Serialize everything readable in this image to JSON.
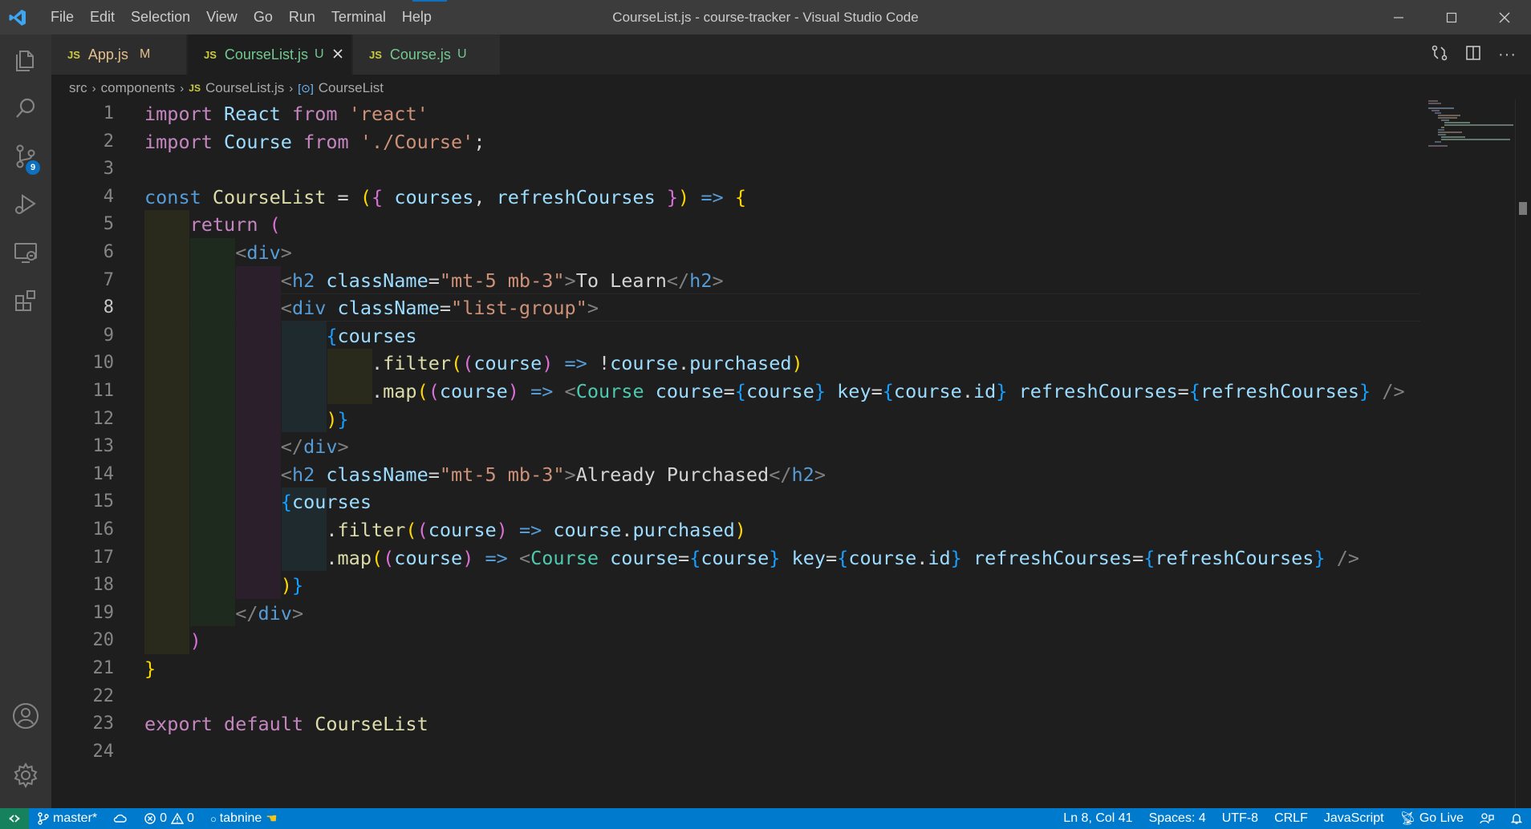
{
  "titlebar": {
    "menu": [
      "File",
      "Edit",
      "Selection",
      "View",
      "Go",
      "Run",
      "Terminal",
      "Help"
    ],
    "title": "CourseList.js - course-tracker - Visual Studio Code",
    "controls": [
      "minimize-icon",
      "maximize-icon",
      "close-icon"
    ]
  },
  "activity": {
    "items": [
      "explorer-icon",
      "search-icon",
      "source-control-icon",
      "run-debug-icon",
      "remote-explorer-icon",
      "extensions-icon",
      "account-icon",
      "settings-gear-icon"
    ],
    "scm_badge": "9"
  },
  "tabs": [
    {
      "icon": "JS",
      "name": "App.js",
      "status": "M",
      "active": false
    },
    {
      "icon": "JS",
      "name": "CourseList.js",
      "status": "U",
      "active": true
    },
    {
      "icon": "JS",
      "name": "Course.js",
      "status": "U",
      "active": false
    }
  ],
  "breadcrumb": {
    "parts": [
      "src",
      "components"
    ],
    "file_icon": "JS",
    "file": "CourseList.js",
    "symbol": "CourseList"
  },
  "editor": {
    "current_line": 8,
    "line_numbers": [
      "1",
      "2",
      "3",
      "4",
      "5",
      "6",
      "7",
      "8",
      "9",
      "10",
      "11",
      "12",
      "13",
      "14",
      "15",
      "16",
      "17",
      "18",
      "19",
      "20",
      "21",
      "22",
      "23",
      "24"
    ],
    "lines": [
      [
        [
          "kw",
          "import"
        ],
        [
          "txt",
          " "
        ],
        [
          "var",
          "React"
        ],
        [
          "txt",
          " "
        ],
        [
          "kw",
          "from"
        ],
        [
          "txt",
          " "
        ],
        [
          "st",
          "'react'"
        ]
      ],
      [
        [
          "kw",
          "import"
        ],
        [
          "txt",
          " "
        ],
        [
          "var",
          "Course"
        ],
        [
          "txt",
          " "
        ],
        [
          "kw",
          "from"
        ],
        [
          "txt",
          " "
        ],
        [
          "st",
          "'./Course'"
        ],
        [
          "txt",
          ";"
        ]
      ],
      [],
      [
        [
          "dcl",
          "const"
        ],
        [
          "txt",
          " "
        ],
        [
          "fn",
          "CourseList"
        ],
        [
          "txt",
          " = "
        ],
        [
          "br1",
          "("
        ],
        [
          "br2",
          "{"
        ],
        [
          "txt",
          " "
        ],
        [
          "var",
          "courses"
        ],
        [
          "txt",
          ", "
        ],
        [
          "var",
          "refreshCourses"
        ],
        [
          "txt",
          " "
        ],
        [
          "br2",
          "}"
        ],
        [
          "br1",
          ")"
        ],
        [
          "txt",
          " "
        ],
        [
          "dcl",
          "=>"
        ],
        [
          "txt",
          " "
        ],
        [
          "br1",
          "{"
        ]
      ],
      [
        [
          "txt",
          "    "
        ],
        [
          "kw",
          "return"
        ],
        [
          "txt",
          " "
        ],
        [
          "br2",
          "("
        ]
      ],
      [
        [
          "txt",
          "        "
        ],
        [
          "ang",
          "<"
        ],
        [
          "tag",
          "div"
        ],
        [
          "ang",
          ">"
        ]
      ],
      [
        [
          "txt",
          "            "
        ],
        [
          "ang",
          "<"
        ],
        [
          "tag",
          "h2"
        ],
        [
          "txt",
          " "
        ],
        [
          "var",
          "className"
        ],
        [
          "txt",
          "="
        ],
        [
          "st",
          "\"mt-5 mb-3\""
        ],
        [
          "ang",
          ">"
        ],
        [
          "txt",
          "To Learn"
        ],
        [
          "ang",
          "</"
        ],
        [
          "tag",
          "h2"
        ],
        [
          "ang",
          ">"
        ]
      ],
      [
        [
          "txt",
          "            "
        ],
        [
          "ang",
          "<"
        ],
        [
          "tag",
          "div"
        ],
        [
          "txt",
          " "
        ],
        [
          "var",
          "className"
        ],
        [
          "txt",
          "="
        ],
        [
          "st",
          "\"list-group\""
        ],
        [
          "ang",
          ">"
        ]
      ],
      [
        [
          "txt",
          "                "
        ],
        [
          "br3",
          "{"
        ],
        [
          "var",
          "courses"
        ]
      ],
      [
        [
          "txt",
          "                    ."
        ],
        [
          "fn",
          "filter"
        ],
        [
          "br1",
          "("
        ],
        [
          "br2",
          "("
        ],
        [
          "var",
          "course"
        ],
        [
          "br2",
          ")"
        ],
        [
          "txt",
          " "
        ],
        [
          "dcl",
          "=>"
        ],
        [
          "txt",
          " !"
        ],
        [
          "var",
          "course"
        ],
        [
          "txt",
          "."
        ],
        [
          "var",
          "purchased"
        ],
        [
          "br1",
          ")"
        ]
      ],
      [
        [
          "txt",
          "                    ."
        ],
        [
          "fn",
          "map"
        ],
        [
          "br1",
          "("
        ],
        [
          "br2",
          "("
        ],
        [
          "var",
          "course"
        ],
        [
          "br2",
          ")"
        ],
        [
          "txt",
          " "
        ],
        [
          "dcl",
          "=>"
        ],
        [
          "txt",
          " "
        ],
        [
          "ang",
          "<"
        ],
        [
          "cls",
          "Course"
        ],
        [
          "txt",
          " "
        ],
        [
          "var",
          "course"
        ],
        [
          "txt",
          "="
        ],
        [
          "br3",
          "{"
        ],
        [
          "var",
          "course"
        ],
        [
          "br3",
          "}"
        ],
        [
          "txt",
          " "
        ],
        [
          "var",
          "key"
        ],
        [
          "txt",
          "="
        ],
        [
          "br3",
          "{"
        ],
        [
          "var",
          "course"
        ],
        [
          "txt",
          "."
        ],
        [
          "var",
          "id"
        ],
        [
          "br3",
          "}"
        ],
        [
          "txt",
          " "
        ],
        [
          "var",
          "refreshCourses"
        ],
        [
          "txt",
          "="
        ],
        [
          "br3",
          "{"
        ],
        [
          "var",
          "refreshCourses"
        ],
        [
          "br3",
          "}"
        ],
        [
          "txt",
          " "
        ],
        [
          "ang",
          "/>"
        ]
      ],
      [
        [
          "txt",
          "                "
        ],
        [
          "br1",
          ")"
        ],
        [
          "br3",
          "}"
        ]
      ],
      [
        [
          "txt",
          "            "
        ],
        [
          "ang",
          "</"
        ],
        [
          "tag",
          "div"
        ],
        [
          "ang",
          ">"
        ]
      ],
      [
        [
          "txt",
          "            "
        ],
        [
          "ang",
          "<"
        ],
        [
          "tag",
          "h2"
        ],
        [
          "txt",
          " "
        ],
        [
          "var",
          "className"
        ],
        [
          "txt",
          "="
        ],
        [
          "st",
          "\"mt-5 mb-3\""
        ],
        [
          "ang",
          ">"
        ],
        [
          "txt",
          "Already Purchased"
        ],
        [
          "ang",
          "</"
        ],
        [
          "tag",
          "h2"
        ],
        [
          "ang",
          ">"
        ]
      ],
      [
        [
          "txt",
          "            "
        ],
        [
          "br3",
          "{"
        ],
        [
          "var",
          "courses"
        ]
      ],
      [
        [
          "txt",
          "                ."
        ],
        [
          "fn",
          "filter"
        ],
        [
          "br1",
          "("
        ],
        [
          "br2",
          "("
        ],
        [
          "var",
          "course"
        ],
        [
          "br2",
          ")"
        ],
        [
          "txt",
          " "
        ],
        [
          "dcl",
          "=>"
        ],
        [
          "txt",
          " "
        ],
        [
          "var",
          "course"
        ],
        [
          "txt",
          "."
        ],
        [
          "var",
          "purchased"
        ],
        [
          "br1",
          ")"
        ]
      ],
      [
        [
          "txt",
          "                ."
        ],
        [
          "fn",
          "map"
        ],
        [
          "br1",
          "("
        ],
        [
          "br2",
          "("
        ],
        [
          "var",
          "course"
        ],
        [
          "br2",
          ")"
        ],
        [
          "txt",
          " "
        ],
        [
          "dcl",
          "=>"
        ],
        [
          "txt",
          " "
        ],
        [
          "ang",
          "<"
        ],
        [
          "cls",
          "Course"
        ],
        [
          "txt",
          " "
        ],
        [
          "var",
          "course"
        ],
        [
          "txt",
          "="
        ],
        [
          "br3",
          "{"
        ],
        [
          "var",
          "course"
        ],
        [
          "br3",
          "}"
        ],
        [
          "txt",
          " "
        ],
        [
          "var",
          "key"
        ],
        [
          "txt",
          "="
        ],
        [
          "br3",
          "{"
        ],
        [
          "var",
          "course"
        ],
        [
          "txt",
          "."
        ],
        [
          "var",
          "id"
        ],
        [
          "br3",
          "}"
        ],
        [
          "txt",
          " "
        ],
        [
          "var",
          "refreshCourses"
        ],
        [
          "txt",
          "="
        ],
        [
          "br3",
          "{"
        ],
        [
          "var",
          "refreshCourses"
        ],
        [
          "br3",
          "}"
        ],
        [
          "txt",
          " "
        ],
        [
          "ang",
          "/>"
        ]
      ],
      [
        [
          "txt",
          "            "
        ],
        [
          "br1",
          ")"
        ],
        [
          "br3",
          "}"
        ]
      ],
      [
        [
          "txt",
          "        "
        ],
        [
          "ang",
          "</"
        ],
        [
          "tag",
          "div"
        ],
        [
          "ang",
          ">"
        ]
      ],
      [
        [
          "txt",
          "    "
        ],
        [
          "br2",
          ")"
        ]
      ],
      [
        [
          "br1",
          "}"
        ]
      ],
      [],
      [
        [
          "kw",
          "export"
        ],
        [
          "txt",
          " "
        ],
        [
          "kw",
          "default"
        ],
        [
          "txt",
          " "
        ],
        [
          "fn",
          "CourseList"
        ]
      ],
      []
    ]
  },
  "statusbar": {
    "branch": "master*",
    "errors": "0",
    "warnings": "0",
    "tabnine": "tabnine",
    "position": "Ln 8, Col 41",
    "spaces": "Spaces: 4",
    "encoding": "UTF-8",
    "eol": "CRLF",
    "language": "JavaScript",
    "golive": "Go Live"
  },
  "colors": {
    "accent": "#007acc",
    "remote": "#16825d",
    "modified": "#e2c08d",
    "untracked": "#73c991",
    "js_icon": "#cbcb41"
  }
}
